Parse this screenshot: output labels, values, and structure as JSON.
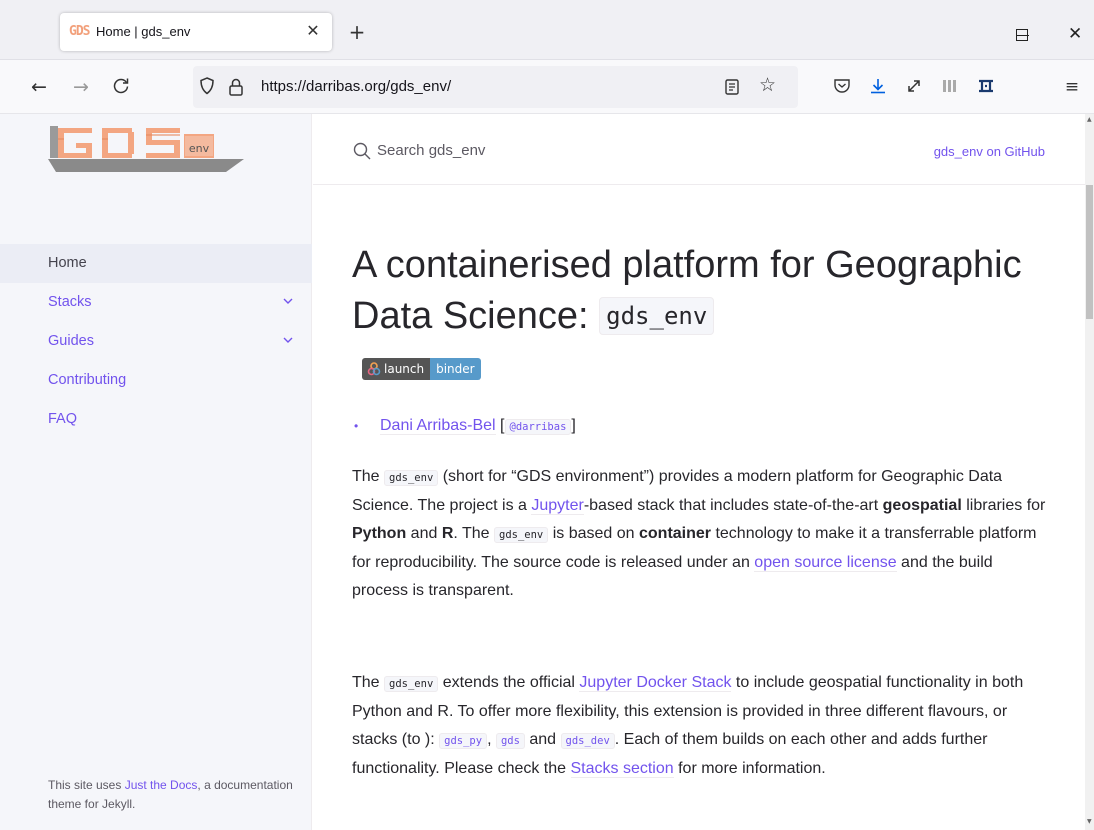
{
  "browser": {
    "tab_title": "Home | gds_env",
    "tab_favicon_text": "GDS",
    "new_tab_symbol": "+",
    "url": "https://darribas.org/gds_env/"
  },
  "icons": {
    "back": "arrow-left-icon",
    "forward": "arrow-right-icon",
    "reload": "reload-icon",
    "bookmark": "star-icon",
    "pocket": "pocket-icon",
    "download": "download-icon",
    "fullscreen": "expand-icon",
    "library": "library-icon",
    "extension": "extension-icon",
    "menu": "hamburger-menu-icon"
  },
  "colors": {
    "link": "#7253ed",
    "sidebar_bg": "#f5f6fa",
    "download_accent": "#0060df",
    "binder_blue": "#579aca"
  },
  "logo": {
    "badge_text": "env"
  },
  "sidebar": {
    "items": [
      {
        "label": "Home",
        "active": true
      },
      {
        "label": "Stacks",
        "expandable": true
      },
      {
        "label": "Guides",
        "expandable": true
      },
      {
        "label": "Contributing"
      },
      {
        "label": "FAQ"
      }
    ],
    "footer": {
      "prefix": "This site uses ",
      "link": "Just the Docs",
      "suffix": ", a documentation theme for Jekyll."
    }
  },
  "header": {
    "search_placeholder": "Search gds_env",
    "github_link": "gds_env on GitHub"
  },
  "main": {
    "title_text": "A containerised platform for Geographic Data Science: ",
    "title_code": "gds_env",
    "binder_left": "launch",
    "binder_right": "binder",
    "author_name": "Dani Arribas-Bel",
    "author_handle": "@darribas",
    "author_bracket_open": " [",
    "author_bracket_close": "]",
    "p1": {
      "t1": "The ",
      "c1": "gds_env",
      "t2": " (short for “GDS environment”) provides a modern platform for Geographic Data Science. The project is a ",
      "l1": "Jupyter",
      "t3": "-based stack that includes state-of-the-art ",
      "b1": "geospatial",
      "t4": " libraries for ",
      "b2": "Python",
      "t5": " and ",
      "b3": "R",
      "t6": ". The ",
      "c2": "gds_env",
      "t7": " is based on ",
      "b4": "container",
      "t8": " technology to make it a transferrable platform for reproducibility. The source code is released under an ",
      "l2": "open source license",
      "t9": " and the build process is transparent."
    },
    "p2": {
      "t1": "The ",
      "c1": "gds_env",
      "t2": " extends the official ",
      "l1": "Jupyter Docker Stack",
      "t3": " to include geospatial functionality in both Python and R. To offer more flexibility, this extension is provided in three different flavours, or stacks (to ): ",
      "c2": "gds_py",
      "t4": ", ",
      "c3": "gds",
      "t5": " and ",
      "c4": "gds_dev",
      "t6": ". Each of them builds on each other and adds further functionality. Please check the ",
      "l2": "Stacks section",
      "t7": " for more information."
    }
  }
}
